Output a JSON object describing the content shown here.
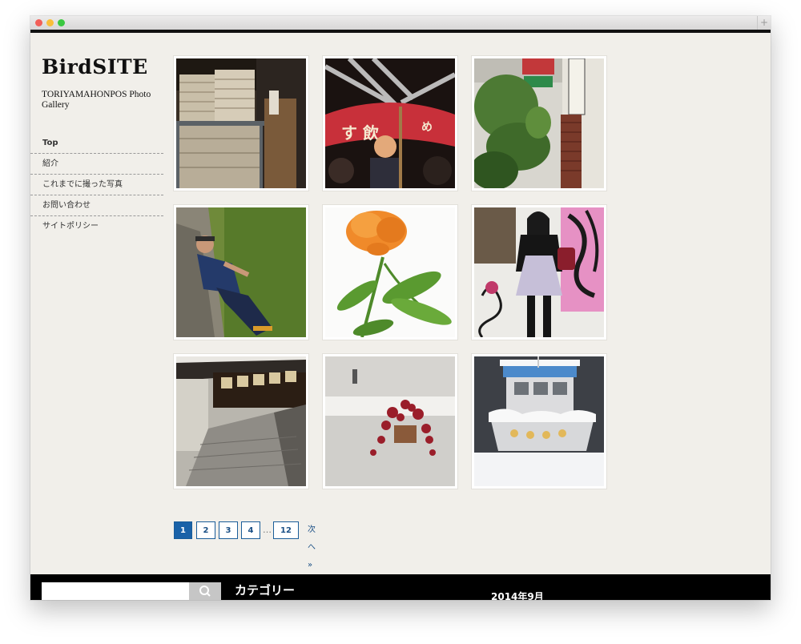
{
  "site": {
    "title": "BirdSITE",
    "description": "TORIYAMAHONPOS Photo Gallery"
  },
  "nav": {
    "items": [
      {
        "label": "Top",
        "active": true
      },
      {
        "label": "紹介",
        "active": false
      },
      {
        "label": "これまでに撮った写真",
        "active": false
      },
      {
        "label": "お問い合わせ",
        "active": false
      },
      {
        "label": "サイトポリシー",
        "active": false
      }
    ]
  },
  "gallery": {
    "photos": [
      {
        "subject": "stacked books in a shop"
      },
      {
        "subject": "festival lanterns and crowd at night"
      },
      {
        "subject": "ivy-covered shop front with signs"
      },
      {
        "subject": "man leaning on mossy rock"
      },
      {
        "subject": "orange cockscomb flower"
      },
      {
        "subject": "woman with pink graffiti wall"
      },
      {
        "subject": "stone-paved alley with old houses"
      },
      {
        "subject": "red plant on snowy step"
      },
      {
        "subject": "boat covered in snow"
      }
    ]
  },
  "pagination": {
    "pages": [
      "1",
      "2",
      "3",
      "4"
    ],
    "current": "1",
    "ellipsis": "…",
    "last": "12",
    "next_label": "次へ »"
  },
  "footer": {
    "search_placeholder": "",
    "categories_heading": "カテゴリー",
    "archive_heading": "2014年9月"
  },
  "icons": {
    "search": "search-icon"
  },
  "colors": {
    "background": "#f1efea",
    "accent": "#1a62a8",
    "footer": "#000000"
  }
}
